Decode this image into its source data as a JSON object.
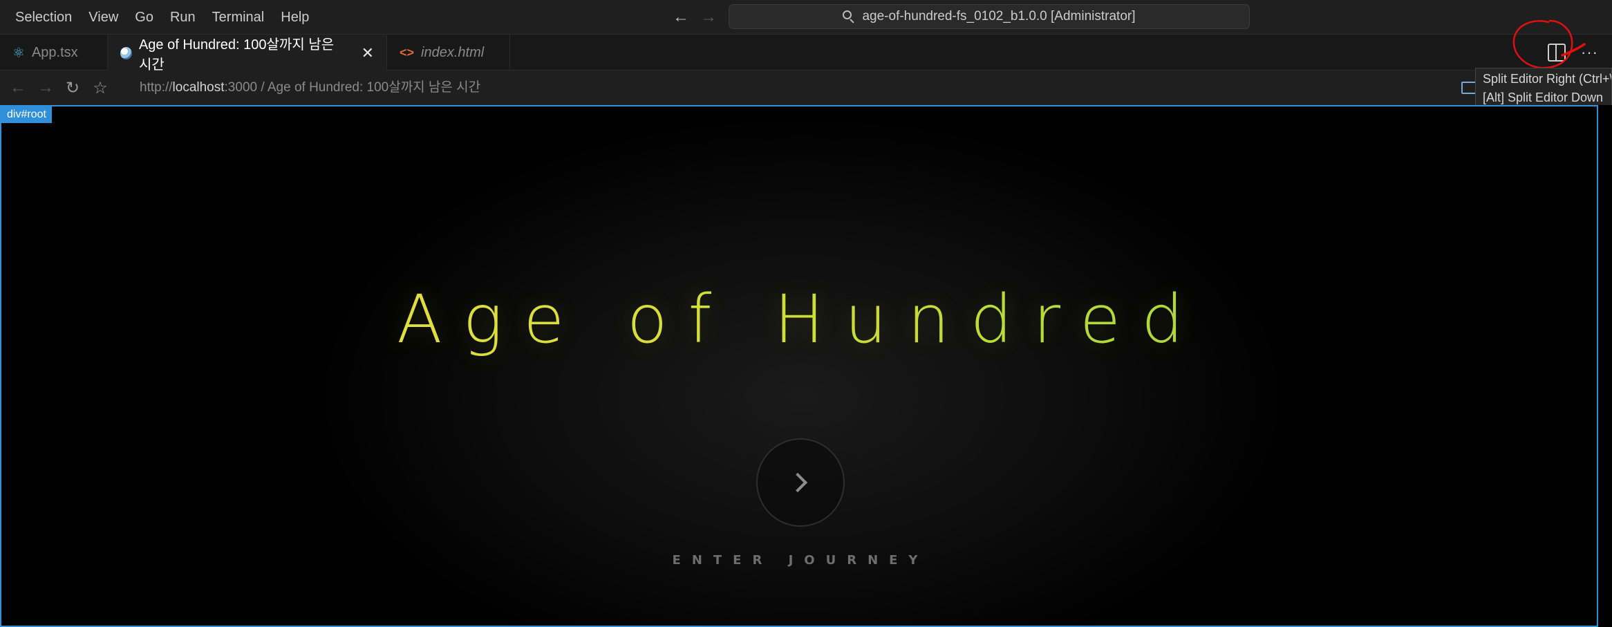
{
  "menu": [
    "Selection",
    "View",
    "Go",
    "Run",
    "Terminal",
    "Help"
  ],
  "command_center": {
    "text": "age-of-hundred-fs_0102_b1.0.0 [Administrator]"
  },
  "tabs": [
    {
      "label": "App.tsx",
      "icon": "react-icon"
    },
    {
      "label": "Age of Hundred: 100살까지 남은 시간",
      "icon": "globe-icon",
      "close": "✕"
    },
    {
      "label": "index.html",
      "icon": "html-icon"
    }
  ],
  "browser": {
    "url_prefix": "http://",
    "url_host": "localhost",
    "url_rest": ":3000 / Age of Hundred: 100살까지 남은 시간"
  },
  "tooltip": {
    "line1": "Split Editor Right (Ctrl+\\)",
    "line2": "[Alt] Split Editor Down"
  },
  "page": {
    "root_badge": "div#root",
    "title": "Age of Hundred",
    "enter_label": "ENTER JOURNEY"
  },
  "colors": {
    "accent": "#2f8fd8",
    "title_gradient_start": "#f3df46",
    "title_gradient_end": "#8ed135",
    "annotation": "#e01010"
  }
}
